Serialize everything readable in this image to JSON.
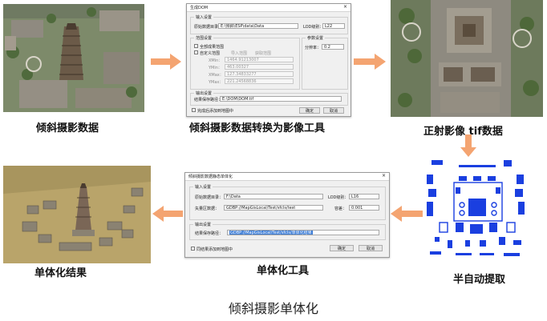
{
  "captions": {
    "oblique_data": "倾斜摄影数据",
    "convert_tool": "倾斜摄影数据转换为影像工具",
    "ortho_data": "正射影像 tif数据",
    "mono_result": "单体化结果",
    "mono_tool": "单体化工具",
    "semi_auto": "半自动提取"
  },
  "bottom_title": "倾斜摄影单体化",
  "dom_dialog": {
    "title": "生成DOM",
    "close_glyph": "×",
    "input_group": "输入设置",
    "data_dir_label": "原始数据目录：",
    "data_dir_value": "E:\\倾斜\\ESP\\data\\Data",
    "lod_label": "LOD级别：",
    "lod_value": "L22",
    "range_group": "范围设置",
    "full_range_label": "全部成果范围",
    "custom_range_label": "自定义范围",
    "coord_options": [
      "导入范围",
      "获取范围"
    ],
    "range_rows": [
      {
        "label": "XMin：",
        "value": "1464.91213007"
      },
      {
        "label": "YMin：",
        "value": "463.00327"
      },
      {
        "label": "XMax：",
        "value": "127.34833277"
      },
      {
        "label": "YMax：",
        "value": "221.24568836"
      }
    ],
    "param_group": "参数设置",
    "resolution_label": "分辨率：",
    "resolution_value": "0.2",
    "output_group": "输出设置",
    "output_label": "结果保存路径：",
    "output_value": "E:\\DOM\\DOM.tif",
    "add_to_map_label": "完成后添加到地图中",
    "ok_label": "确定",
    "cancel_label": "取消"
  },
  "mono_dialog": {
    "title": "倾斜摄影数据静态单体化",
    "close_glyph": "×",
    "input_group": "输入设置",
    "data_dir_label": "原始数据目录：",
    "data_dir_value": "F:\\Data",
    "lod_label": "LOD级别：",
    "lod_value": "L16",
    "vector_label": "矢量区数据：",
    "vector_value": "GDBP://MapGisLocal/Test/sfcls/test",
    "height_label": "容差：",
    "height_value": "0.001",
    "output_group": "输出设置",
    "output_label": "结果保存路径：",
    "output_value": "GDBP://MapGisLocal/Test/sfcls/单体化结果",
    "add_to_map_label": "同结果添加到地图中",
    "ok_label": "确定",
    "cancel_label": "取消"
  },
  "colors": {
    "arrow": "#f4a471",
    "selection": "#3a7bd5",
    "blue_feature": "#1a3fe0",
    "terrain": "#b9a46a"
  }
}
